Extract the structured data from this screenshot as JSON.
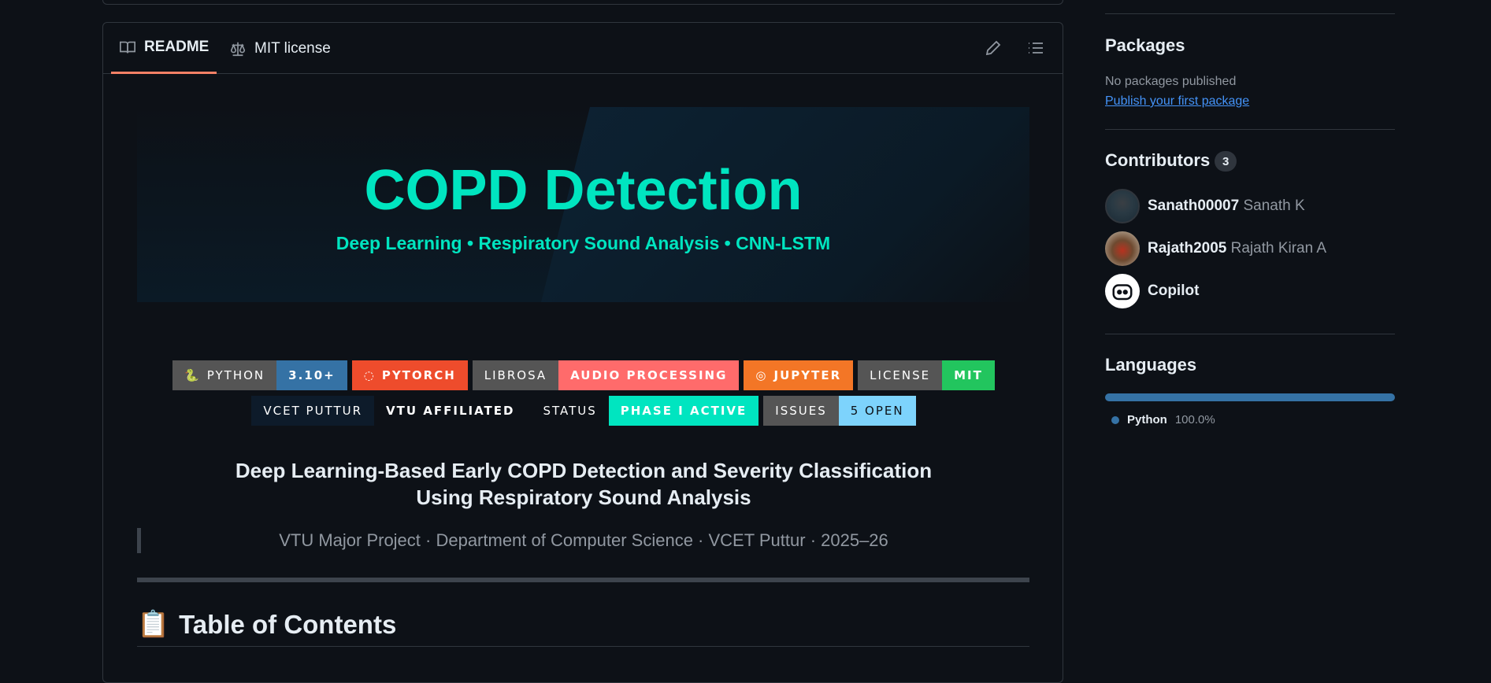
{
  "tabs": {
    "readme": "README",
    "license": "MIT license"
  },
  "hero": {
    "title": "COPD Detection",
    "subtitle": "Deep Learning • Respiratory Sound Analysis • CNN-LSTM"
  },
  "badges_row1": [
    {
      "left": "PYTHON",
      "right": "3.10+",
      "left_color": "#555555",
      "right_color": "#3572a5"
    },
    {
      "label": "PYTORCH",
      "color": "#ee4c2c"
    },
    {
      "left": "LIBROSA",
      "right": "AUDIO PROCESSING",
      "left_color": "#555555",
      "right_color": "#ff6b6b"
    },
    {
      "label": "JUPYTER",
      "color": "#f37626"
    },
    {
      "left": "LICENSE",
      "right": "MIT",
      "left_color": "#555555",
      "right_color": "#22c55e"
    }
  ],
  "badges_row2": [
    {
      "left": "VCET PUTTUR",
      "right": "VTU AFFILIATED",
      "left_color": "#0d1b2a",
      "right_color": "#0d1117"
    },
    {
      "left": "STATUS",
      "right": "PHASE I ACTIVE",
      "left_color": "#0d1117",
      "right_color": "#00e5c0"
    },
    {
      "left": "ISSUES",
      "right": "5 OPEN",
      "left_color": "#555555",
      "right_color": "#7dd3fc"
    }
  ],
  "project": {
    "title_line1": "Deep Learning-Based Early COPD Detection and Severity Classification",
    "title_line2": "Using Respiratory Sound Analysis",
    "quote": "VTU Major Project · Department of Computer Science · VCET Puttur · 2025–26"
  },
  "toc": {
    "emoji": "📋",
    "title": "Table of Contents"
  },
  "sidebar": {
    "packages": {
      "heading": "Packages",
      "none": "No packages published",
      "link": "Publish your first package"
    },
    "contributors": {
      "heading": "Contributors",
      "count": "3",
      "list": [
        {
          "login": "Sanath00007",
          "name": "Sanath K"
        },
        {
          "login": "Rajath2005",
          "name": "Rajath Kiran A"
        },
        {
          "login": "Copilot",
          "name": ""
        }
      ]
    },
    "languages": {
      "heading": "Languages",
      "items": [
        {
          "name": "Python",
          "percent": "100.0%",
          "color": "#3572a5"
        }
      ]
    }
  }
}
